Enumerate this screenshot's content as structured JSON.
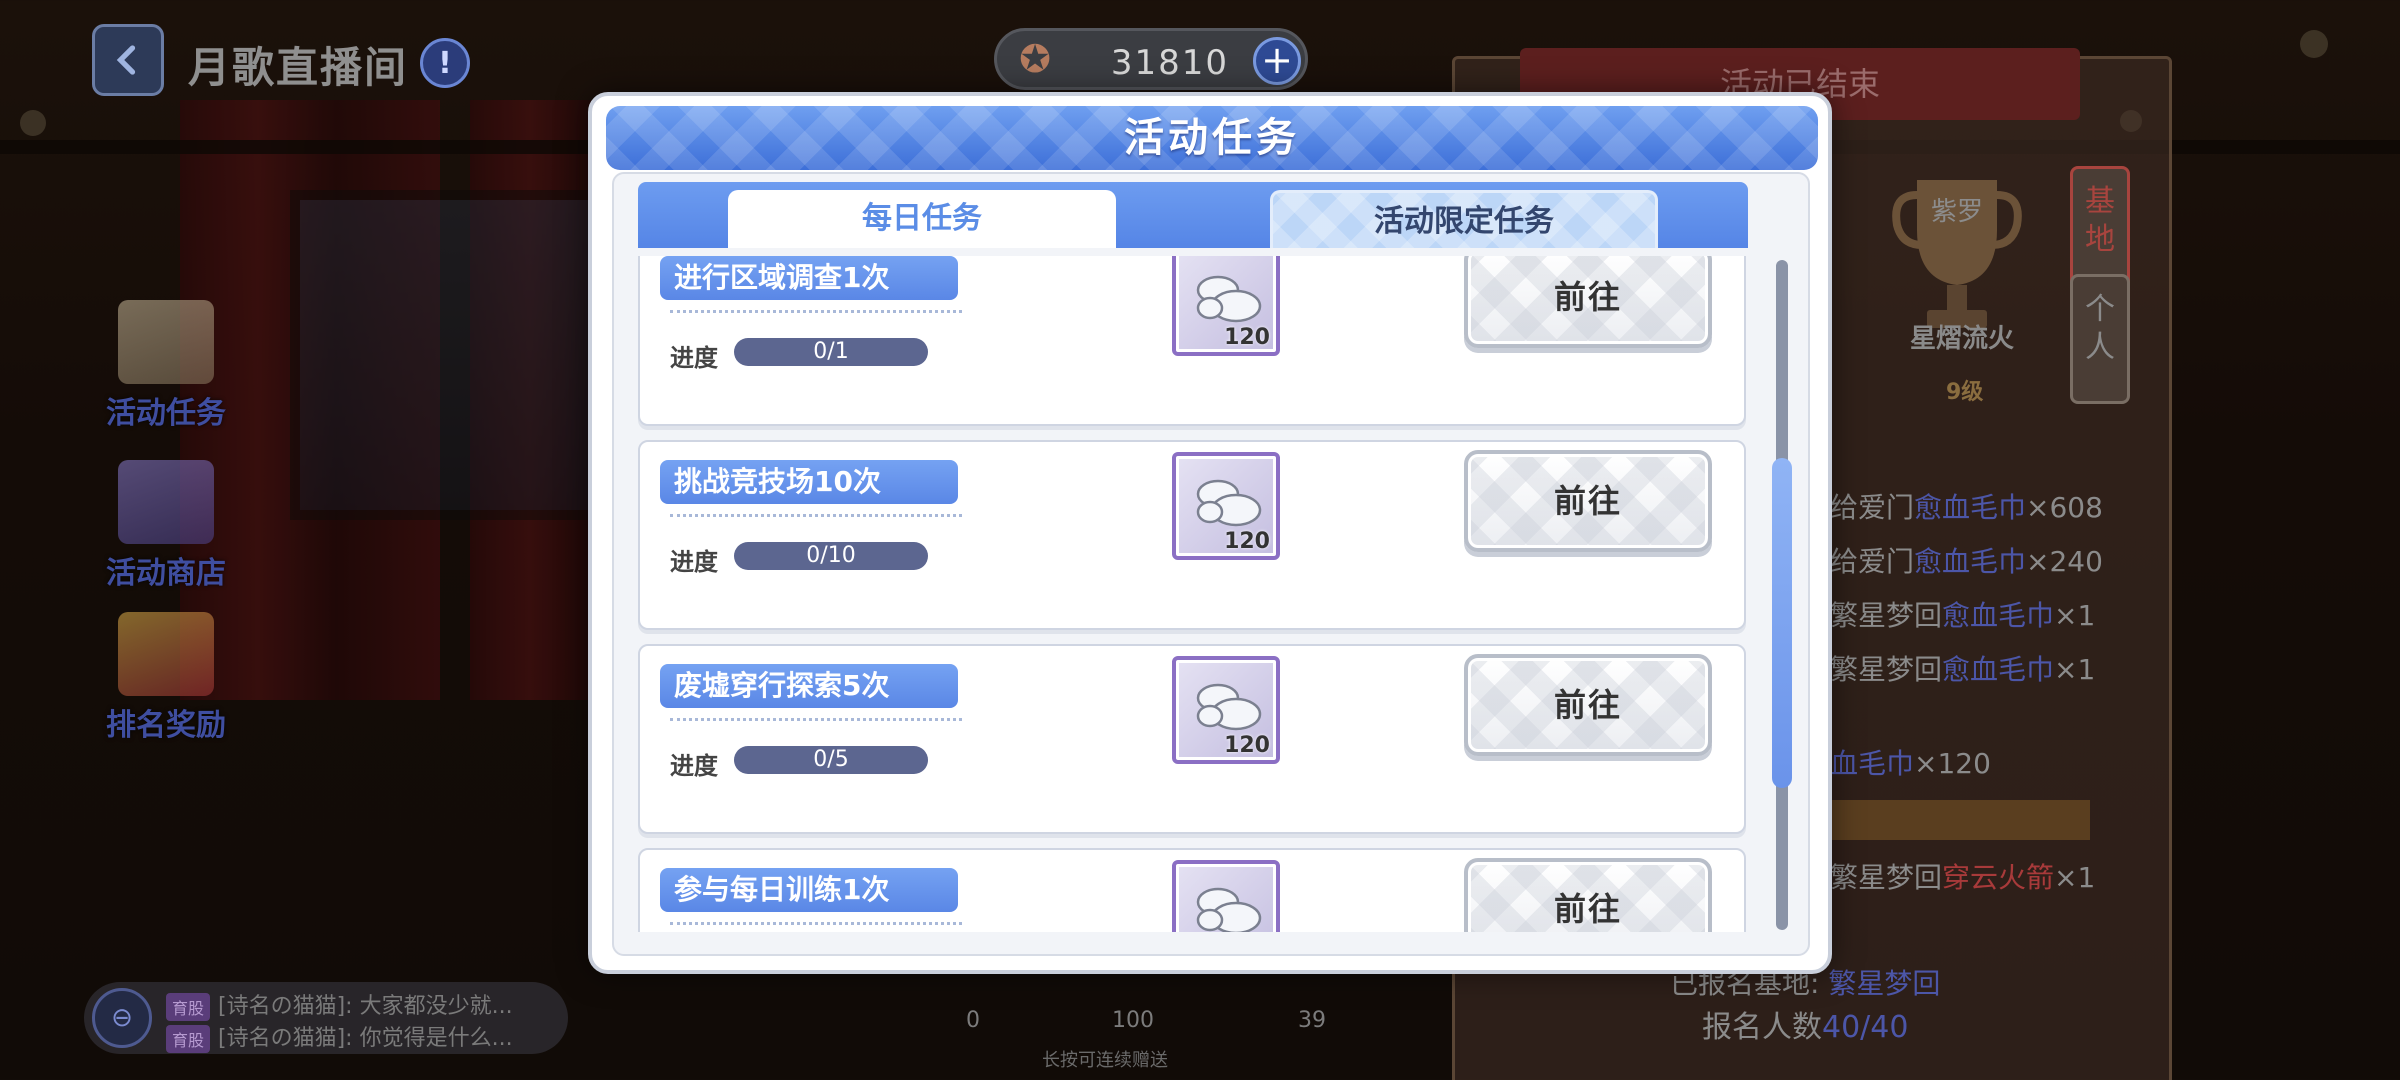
{
  "header": {
    "title": "月歌直播间",
    "currency_value": "31810",
    "icons": {
      "back": "chevron-left-icon",
      "info": "exclamation-icon",
      "currency": "star-badge-icon",
      "add": "plus-icon"
    }
  },
  "side_menu": {
    "items": [
      {
        "label": "活动任务",
        "icon": "document-stack-icon"
      },
      {
        "label": "活动商店",
        "icon": "shop-icon"
      },
      {
        "label": "排名奖励",
        "icon": "gift-icon"
      }
    ]
  },
  "chat": {
    "lines": [
      {
        "tag": "育股",
        "text": "[诗名の猫猫]: 大家都没少就..."
      },
      {
        "tag": "育股",
        "text": "[诗名の猫猫]: 你觉得是什么..."
      }
    ]
  },
  "bottom": {
    "items": [
      "0",
      "100",
      "39"
    ],
    "hint": "长按可连续赠送"
  },
  "right_panel": {
    "banner": "活动已结束",
    "trophy_text": "紫罗",
    "trophy_name": "星熠流火",
    "trophy_level": "9级",
    "tabs": [
      "基地",
      "个人"
    ],
    "rewards": [
      {
        "prefix": "给爱门",
        "item": "愈血毛巾",
        "qty": "×608"
      },
      {
        "prefix": "给爱门",
        "item": "愈血毛巾",
        "qty": "×240"
      },
      {
        "prefix": "繁星梦回",
        "item": "愈血毛巾",
        "qty": "×1"
      },
      {
        "prefix": "繁星梦回",
        "item": "愈血毛巾",
        "qty": "×1"
      },
      {
        "prefix": "",
        "item": "血毛巾",
        "qty": "×120"
      },
      {
        "prefix": "繁星梦回",
        "item": "穿云火箭",
        "qty": "×1"
      }
    ],
    "registered_label": "已报名基地:",
    "registered_base": "繁星梦回",
    "count_label": "报名人数",
    "count_value": "40/40"
  },
  "modal": {
    "title": "活动任务",
    "tabs": {
      "daily": "每日任务",
      "limited": "活动限定任务"
    },
    "progress_label": "进度",
    "button_label": "前往",
    "tasks": [
      {
        "title": "进行区域调查1次",
        "progress": "0/1",
        "reward_icon": "towel-icon",
        "reward_qty": "120"
      },
      {
        "title": "挑战竞技场10次",
        "progress": "0/10",
        "reward_icon": "towel-icon",
        "reward_qty": "120"
      },
      {
        "title": "废墟穿行探索5次",
        "progress": "0/5",
        "reward_icon": "towel-icon",
        "reward_qty": "120"
      },
      {
        "title": "参与每日训练1次",
        "progress": "",
        "reward_icon": "towel-icon",
        "reward_qty": ""
      }
    ],
    "scroll_fraction": 0.3
  },
  "colors": {
    "accent": "#5b8de6",
    "reward_border": "#8b6fc4",
    "progress_bar": "#5c6690"
  }
}
